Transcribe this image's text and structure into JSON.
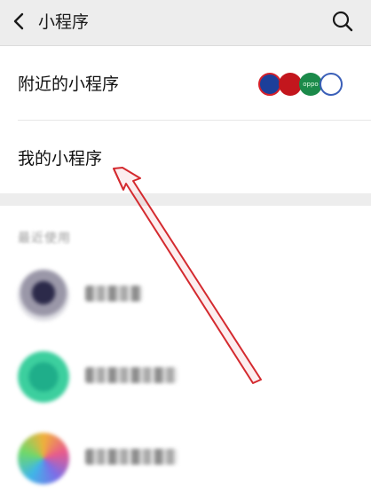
{
  "navbar": {
    "title": "小程序",
    "back_icon": "chevron-left-icon",
    "search_icon": "search-icon"
  },
  "menu": {
    "nearby_label": "附近的小程序",
    "mine_label": "我的小程序",
    "nearby_thumbnails": [
      {
        "icon": "mini-program-logo-icon",
        "text": " "
      },
      {
        "icon": "mini-program-logo-icon",
        "text": " "
      },
      {
        "icon": "oppo-logo-icon",
        "text": "oppo"
      },
      {
        "icon": "mini-program-logo-icon",
        "text": " "
      }
    ]
  },
  "recent": {
    "section_title": "最近使用"
  },
  "colors": {
    "navbar_bg": "#ededed",
    "separator_bg": "#ededed",
    "annotation_arrow": "#d42a2f",
    "text_primary": "#111111",
    "text_secondary": "#9a9a9a"
  }
}
